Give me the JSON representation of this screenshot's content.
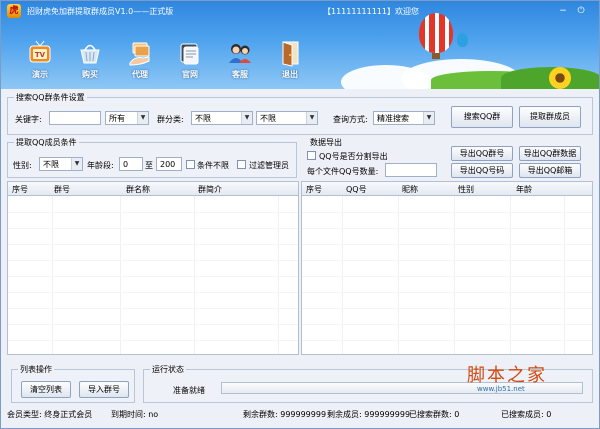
{
  "window": {
    "title": "招财虎免加群提取群成员V1.0——正式版",
    "user_text": "【11111111111】欢迎您",
    "minimize": "−",
    "close": "⏻"
  },
  "toolbar": {
    "items": [
      {
        "label": "演示",
        "icon": "tv-icon"
      },
      {
        "label": "购买",
        "icon": "basket-icon"
      },
      {
        "label": "代理",
        "icon": "hand-money-icon"
      },
      {
        "label": "官网",
        "icon": "browser-icon"
      },
      {
        "label": "客服",
        "icon": "support-people-icon"
      },
      {
        "label": "退出",
        "icon": "door-exit-icon"
      }
    ]
  },
  "search_group": {
    "legend": "搜索QQ群条件设置",
    "keyword_label": "关键字:",
    "keyword_value": "",
    "region_value": "所有",
    "category_label": "群分类:",
    "category_value": "不限",
    "subcategory_value": "不限",
    "query_mode_label": "查询方式:",
    "query_mode_value": "精准搜索",
    "search_button": "搜索QQ群",
    "extract_button": "提取群成员"
  },
  "member_group": {
    "legend": "提取QQ成员条件",
    "gender_label": "性别:",
    "gender_value": "不限",
    "age_label": "年龄段:",
    "age_from": "0",
    "age_to_label": "至",
    "age_to": "200",
    "no_condition_label": "条件不限",
    "filter_admin_label": "过滤管理员"
  },
  "export_group": {
    "legend": "数据导出",
    "split_label": "QQ号是否分割导出",
    "per_file_label": "每个文件QQ号数量:",
    "per_file_value": "",
    "export_group_button": "导出QQ群号",
    "export_group_data_button": "导出QQ群数据",
    "export_qq_button": "导出QQ号码",
    "export_email_button": "导出QQ邮箱"
  },
  "left_table": {
    "columns": [
      "序号",
      "群号",
      "群名称",
      "群简介"
    ]
  },
  "right_table": {
    "columns": [
      "序号",
      "QQ号",
      "昵称",
      "性别",
      "年龄"
    ]
  },
  "list_ops": {
    "legend": "列表操作",
    "clear_button": "清空列表",
    "import_button": "导入群号"
  },
  "run_status": {
    "legend": "运行状态",
    "status_text": "准备就绪",
    "progress": 0
  },
  "statusbar": {
    "member_type": "会员类型: 终身正式会员",
    "expire": "到期时间: no",
    "remain_groups": "剩余群数: 999999999",
    "remain_members": "剩余成员: 999999999",
    "searched_groups": "已搜索群数: 0",
    "searched_members": "已搜索成员: 0"
  },
  "watermark": {
    "text": "脚本之家",
    "url": "www.jb51.net"
  },
  "colors": {
    "header_top": "#2f86de",
    "header_bottom": "#8fc7f5",
    "border": "#7a9cc6",
    "watermark": "#d24a12"
  }
}
